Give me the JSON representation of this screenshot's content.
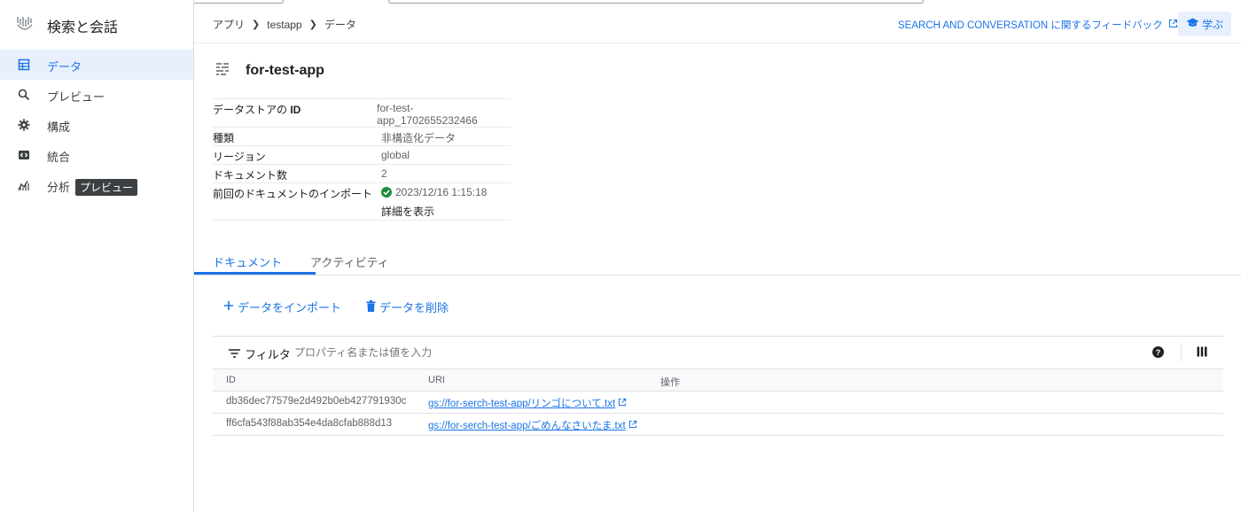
{
  "app": {
    "name": "検索と会話"
  },
  "sidebar": {
    "items": [
      {
        "label": "データ",
        "active": true
      },
      {
        "label": "プレビュー",
        "active": false
      },
      {
        "label": "構成",
        "active": false
      },
      {
        "label": "統合",
        "active": false
      },
      {
        "label": "分析",
        "active": false,
        "badge": "プレビュー"
      }
    ]
  },
  "header": {
    "breadcrumb": [
      "アプリ",
      "testapp",
      "データ"
    ],
    "feedback": "SEARCH AND CONVERSATION に関するフィードバック",
    "learn": "学ぶ"
  },
  "datastore": {
    "title": "for-test-app",
    "properties": [
      {
        "key_prefix": "データストアの ",
        "key_bold": "ID",
        "value": "for-test-app_1702655232466"
      },
      {
        "key": "種類",
        "value": "非構造化データ"
      },
      {
        "key": "リージョン",
        "value": "global"
      },
      {
        "key": "ドキュメント数",
        "value": "2"
      },
      {
        "key": "前回のドキュメントのインポート",
        "value": "2023/12/16 1:15:18",
        "link": "詳細を表示"
      }
    ]
  },
  "tabs": [
    {
      "label": "ドキュメント",
      "active": true
    },
    {
      "label": "アクティビティ",
      "active": false
    }
  ],
  "actions": {
    "import": "データをインポート",
    "delete": "データを削除"
  },
  "filter": {
    "label": "フィルタ",
    "placeholder": "プロパティ名または値を入力"
  },
  "table": {
    "columns": [
      "ID",
      "URI",
      "操作"
    ],
    "rows": [
      {
        "id": "db36dec77579e2d492b0eb427791930c",
        "uri": "gs://for-serch-test-app/リンゴについて.txt"
      },
      {
        "id": "ff6cfa543f88ab354e4da8cfab888d13",
        "uri": "gs://for-serch-test-app/ごめんなさいたま.txt"
      }
    ]
  },
  "colors": {
    "accent": "#1a73e8",
    "success": "#1e8e3e",
    "active_bg": "#e8f0fe"
  }
}
